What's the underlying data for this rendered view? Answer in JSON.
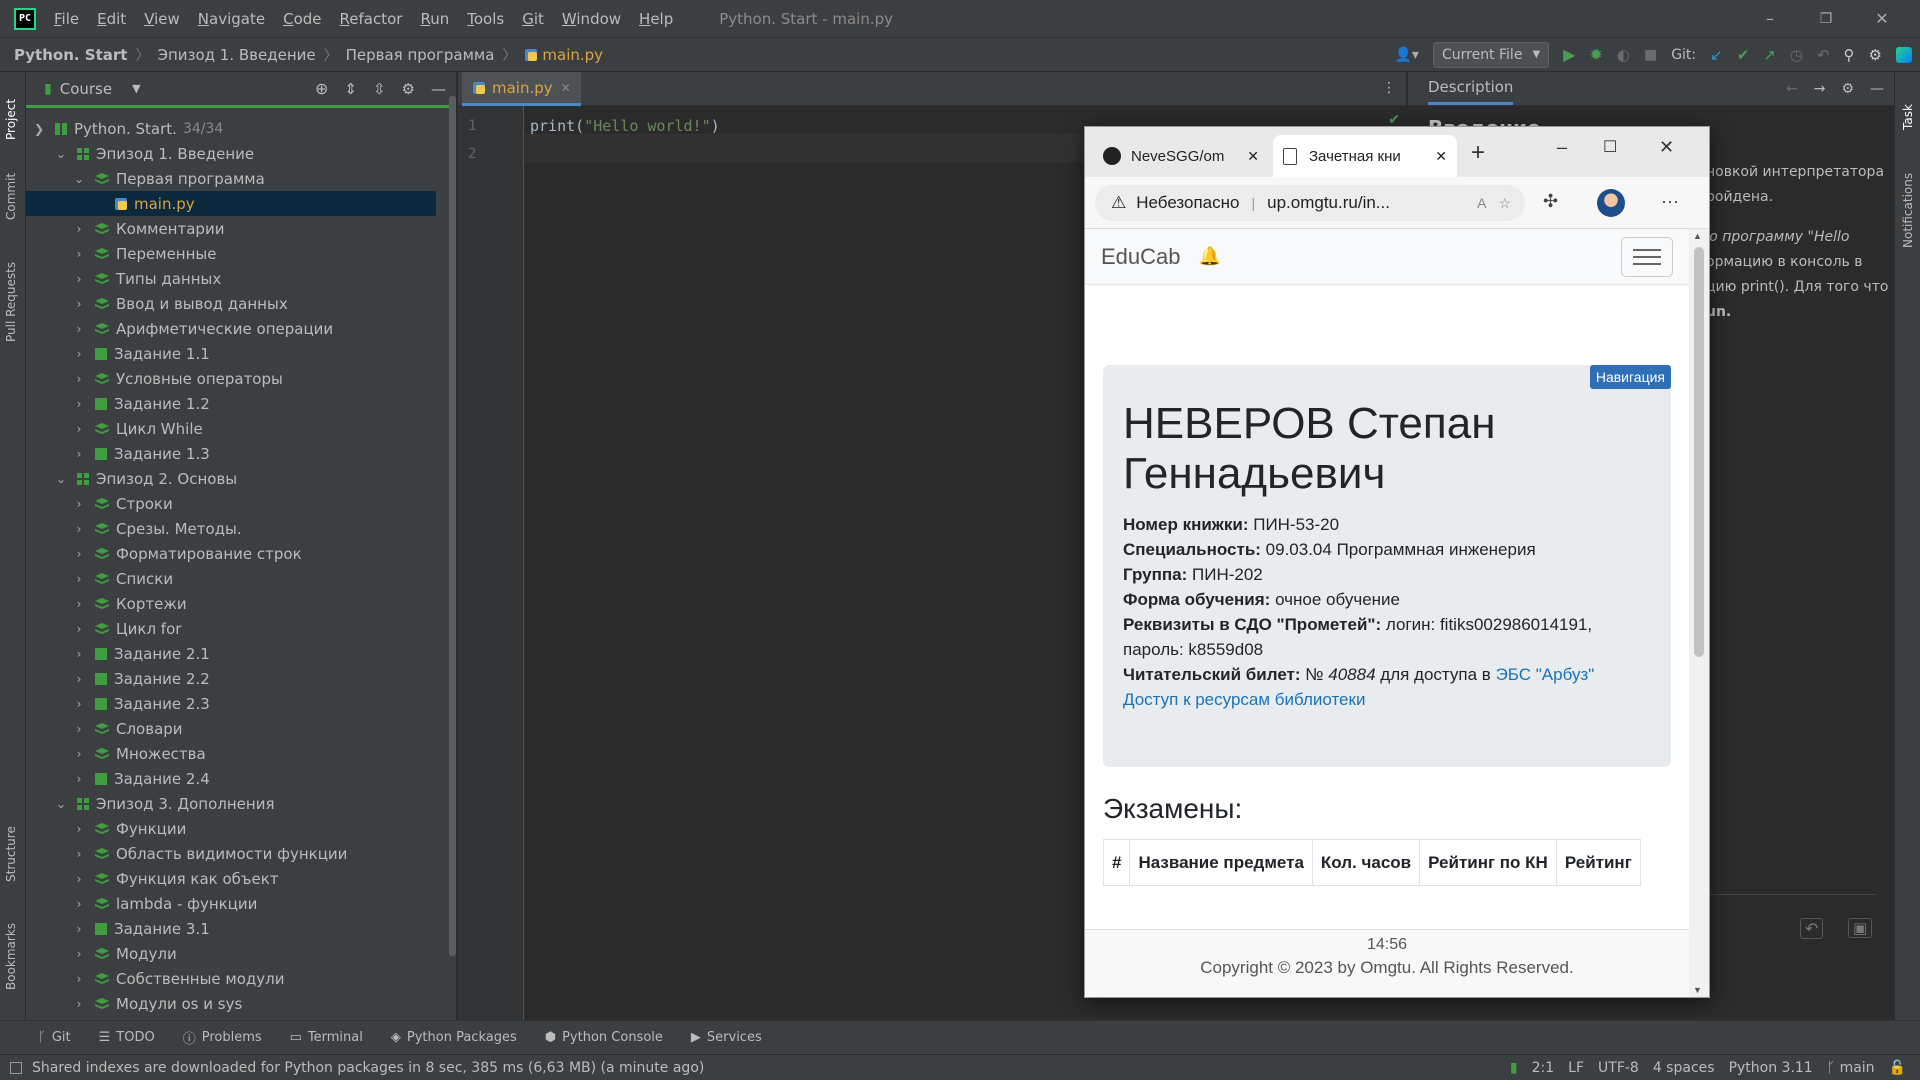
{
  "window": {
    "title": "Python. Start - main.py",
    "menu": [
      "File",
      "Edit",
      "View",
      "Navigate",
      "Code",
      "Refactor",
      "Run",
      "Tools",
      "Git",
      "Window",
      "Help"
    ]
  },
  "breadcrumb": {
    "project": "Python. Start",
    "episode": "Эпизод 1. Введение",
    "lesson": "Первая программа",
    "file": "main.py"
  },
  "toolbar": {
    "run_config": "Current File",
    "git_label": "Git:"
  },
  "project_panel": {
    "title": "Course",
    "root": {
      "label": "Python. Start.",
      "progress": "34/34"
    },
    "items": [
      {
        "label": "Эпизод 1. Введение",
        "level": 1,
        "kind": "section",
        "expanded": true
      },
      {
        "label": "Первая программа",
        "level": 2,
        "kind": "lesson",
        "expanded": true
      },
      {
        "label": "main.py",
        "level": 3,
        "kind": "file",
        "selected": true
      },
      {
        "label": "Комментарии",
        "level": 2,
        "kind": "lesson"
      },
      {
        "label": "Переменные",
        "level": 2,
        "kind": "lesson"
      },
      {
        "label": "Типы данных",
        "level": 2,
        "kind": "lesson"
      },
      {
        "label": "Ввод и вывод данных",
        "level": 2,
        "kind": "lesson"
      },
      {
        "label": "Арифметические операции",
        "level": 2,
        "kind": "lesson"
      },
      {
        "label": "Задание 1.1",
        "level": 2,
        "kind": "task"
      },
      {
        "label": "Условные операторы",
        "level": 2,
        "kind": "lesson"
      },
      {
        "label": "Задание 1.2",
        "level": 2,
        "kind": "task"
      },
      {
        "label": "Цикл While",
        "level": 2,
        "kind": "lesson"
      },
      {
        "label": "Задание 1.3",
        "level": 2,
        "kind": "task"
      },
      {
        "label": "Эпизод 2. Основы",
        "level": 1,
        "kind": "section",
        "expanded": true
      },
      {
        "label": "Строки",
        "level": 2,
        "kind": "lesson"
      },
      {
        "label": "Срезы. Методы.",
        "level": 2,
        "kind": "lesson"
      },
      {
        "label": "Форматирование строк",
        "level": 2,
        "kind": "lesson"
      },
      {
        "label": "Списки",
        "level": 2,
        "kind": "lesson"
      },
      {
        "label": "Кортежи",
        "level": 2,
        "kind": "lesson"
      },
      {
        "label": "Цикл for",
        "level": 2,
        "kind": "lesson"
      },
      {
        "label": "Задание 2.1",
        "level": 2,
        "kind": "task"
      },
      {
        "label": "Задание 2.2",
        "level": 2,
        "kind": "task"
      },
      {
        "label": "Задание 2.3",
        "level": 2,
        "kind": "task"
      },
      {
        "label": "Словари",
        "level": 2,
        "kind": "lesson"
      },
      {
        "label": "Множества",
        "level": 2,
        "kind": "lesson"
      },
      {
        "label": "Задание 2.4",
        "level": 2,
        "kind": "task"
      },
      {
        "label": "Эпизод 3. Дополнения",
        "level": 1,
        "kind": "section",
        "expanded": true
      },
      {
        "label": "Функции",
        "level": 2,
        "kind": "lesson"
      },
      {
        "label": "Область видимости функции",
        "level": 2,
        "kind": "lesson"
      },
      {
        "label": "Функция как объект",
        "level": 2,
        "kind": "lesson"
      },
      {
        "label": "lambda - функции",
        "level": 2,
        "kind": "lesson"
      },
      {
        "label": "Задание 3.1",
        "level": 2,
        "kind": "task"
      },
      {
        "label": "Модули",
        "level": 2,
        "kind": "lesson"
      },
      {
        "label": "Собственные модули",
        "level": 2,
        "kind": "lesson"
      },
      {
        "label": "Модули os и sys",
        "level": 2,
        "kind": "lesson"
      }
    ]
  },
  "side_tabs": {
    "left": [
      "Project",
      "Commit",
      "Pull Requests",
      "Structure",
      "Bookmarks"
    ],
    "right": [
      "Task",
      "Notifications"
    ]
  },
  "editor": {
    "tab": "main.py",
    "line_numbers": [
      "1",
      "2"
    ],
    "code_fn": "print(",
    "code_str": "\"Hello world!\"",
    "code_end": ")"
  },
  "description": {
    "tab": "Description",
    "heading": "Введение",
    "lines": [
      "новкой интерпретатора",
      "ройдена.",
      "ю программу \"Hello",
      "ормацию в консоль в",
      "цию print(). Для того что",
      "un."
    ]
  },
  "browser": {
    "tabs": [
      {
        "label": "NeveSGG/om"
      },
      {
        "label": "Зачетная кни"
      }
    ],
    "security": "Небезопасно",
    "url": "up.omgtu.ru/in...",
    "site": {
      "brand": "EduCab",
      "nav_badge": "Навигация",
      "name": "НЕВЕРОВ Степан Геннадьевич",
      "fields": [
        {
          "label": "Номер книжки:",
          "value": "ПИН-53-20"
        },
        {
          "label": "Специальность:",
          "value": "09.03.04 Программная инженерия"
        },
        {
          "label": "Группа:",
          "value": "ПИН-202"
        },
        {
          "label": "Форма обучения:",
          "value": "очное обучение"
        },
        {
          "label": "Реквизиты в СДО \"Прометей\":",
          "value": "логин: fitiks002986014191,"
        }
      ],
      "password_line": "пароль: k8559d08",
      "library": {
        "label": "Читательский билет:",
        "prefix": "№",
        "number": "40884",
        "middle": "для доступа в",
        "link": "ЭБС \"Арбуз\""
      },
      "library_link": "Доступ к ресурсам библиотеки",
      "exams_title": "Экзамены:",
      "table_headers": [
        "#",
        "Название предмета",
        "Кол. часов",
        "Рейтинг по КН",
        "Рейтинг"
      ],
      "time": "14:56",
      "copyright": "Copyright © 2023 by Omgtu. All Rights Reserved."
    }
  },
  "bottom_tools": [
    "Git",
    "TODO",
    "Problems",
    "Terminal",
    "Python Packages",
    "Python Console",
    "Services"
  ],
  "statusbar": {
    "message": "Shared indexes are downloaded for Python packages in 8 sec, 385 ms (6,63 MB) (a minute ago)",
    "position": "2:1",
    "line_sep": "LF",
    "encoding": "UTF-8",
    "indent": "4 spaces",
    "interpreter": "Python 3.11",
    "branch": "main"
  },
  "colors": {
    "accent_green": "#3f9c3f",
    "link_blue": "#1a73b8",
    "badge_blue": "#2f6fb5",
    "selection": "#0d293e"
  }
}
